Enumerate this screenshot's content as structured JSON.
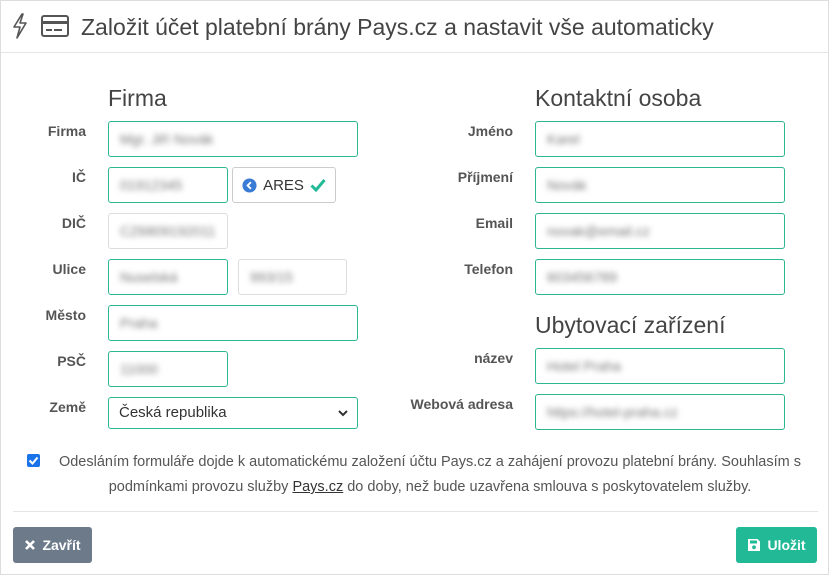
{
  "header": {
    "title": "Založit účet platební brány Pays.cz a nastavit vše automaticky",
    "icons": [
      "bolt-icon",
      "credit-card-icon"
    ]
  },
  "company": {
    "section_title": "Firma",
    "labels": {
      "firma": "Firma",
      "ic": "IČ",
      "dic": "DIČ",
      "ulice": "Ulice",
      "mesto": "Město",
      "psc": "PSČ",
      "zeme": "Země"
    },
    "values": {
      "firma": "Mgr. Jiří Novák",
      "ic": "01912345",
      "dic": "CZ6809192011",
      "ulice": "Nuselská",
      "cislo": "993/15",
      "mesto": "Praha",
      "psc": "11000"
    },
    "ares_label": "ARES",
    "country_selected": "Česká republika"
  },
  "contact": {
    "section_title": "Kontaktní osoba",
    "labels": {
      "jmeno": "Jméno",
      "prijmeni": "Příjmení",
      "email": "Email",
      "telefon": "Telefon"
    },
    "values": {
      "jmeno": "Karel",
      "prijmeni": "Novák",
      "email": "novak@email.cz",
      "telefon": "603456789"
    }
  },
  "accommodation": {
    "section_title": "Ubytovací zařízení",
    "labels": {
      "nazev": "název",
      "web": "Webová adresa"
    },
    "values": {
      "nazev": "Hotel Praha",
      "web": "https://hotel-praha.cz"
    }
  },
  "consent": {
    "checked": true,
    "text_before": "Odesláním formuláře dojde k automatickému založení účtu Pays.cz a zahájení provozu platební brány. Souhlasím s podmínkami provozu služby ",
    "link": "Pays.cz",
    "text_after": " do doby, než bude uzavřena smlouva s poskytovatelem služby."
  },
  "footer": {
    "close_label": "Zavřít",
    "save_label": "Uložit"
  },
  "colors": {
    "accent": "#22b996",
    "input_border": "#2bb78f",
    "close_button": "#6c7a89",
    "checkbox": "#1a73e8",
    "ares_icon": "#3a7bd5",
    "ares_check": "#22b996"
  }
}
